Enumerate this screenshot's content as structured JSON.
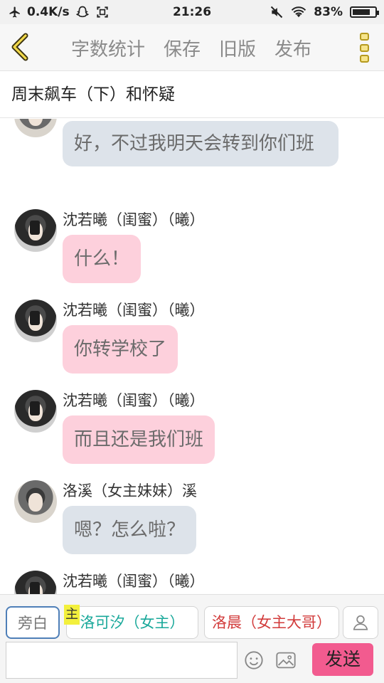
{
  "status_bar": {
    "net_speed": "0.4K/s",
    "time": "21:26",
    "battery": "83%",
    "battery_level": 0.83,
    "icons": [
      "airplane-icon",
      "snapchat-ghost-icon",
      "screenshot-icon",
      "mute-icon",
      "wifi-icon",
      "battery-icon"
    ]
  },
  "toolbar": {
    "back_icon": "chevron-left-icon",
    "actions": [
      "字数统计",
      "保存",
      "旧版",
      "发布"
    ],
    "menu_icon": "vertical-dots-icon"
  },
  "title": "周末飙车（下）和怀疑",
  "messages": [
    {
      "sender": "",
      "text": "好，不过我明天会转到你们班",
      "style": "grey"
    },
    {
      "sender": "沈若曦（闺蜜）（曦）",
      "text": "什么！",
      "style": "pink"
    },
    {
      "sender": "沈若曦（闺蜜）（曦）",
      "text": "你转学校了",
      "style": "pink"
    },
    {
      "sender": "沈若曦（闺蜜）（曦）",
      "text": "而且还是我们班",
      "style": "pink"
    },
    {
      "sender": "洛溪（女主妹妹）溪",
      "text": "嗯？怎么啦？",
      "style": "grey"
    },
    {
      "sender": "沈若曦（闺蜜）（曦）",
      "text": "",
      "style": "pink"
    }
  ],
  "characters": {
    "narration": "旁白",
    "heroine": "洛可汐（女主）",
    "heroine_badge": "主",
    "brother": "洛晨（女主大哥）",
    "profile_icon": "person-icon"
  },
  "composer": {
    "input_value": "",
    "emoji_icon": "emoji-icon",
    "image_icon": "image-icon",
    "send_label": "发送"
  },
  "colors": {
    "pink_bubble": "#fdd0dc",
    "grey_bubble": "#dde3ea",
    "send_button": "#f25b8f",
    "heroine_text": "#19a89a",
    "brother_text": "#d23b3b"
  }
}
